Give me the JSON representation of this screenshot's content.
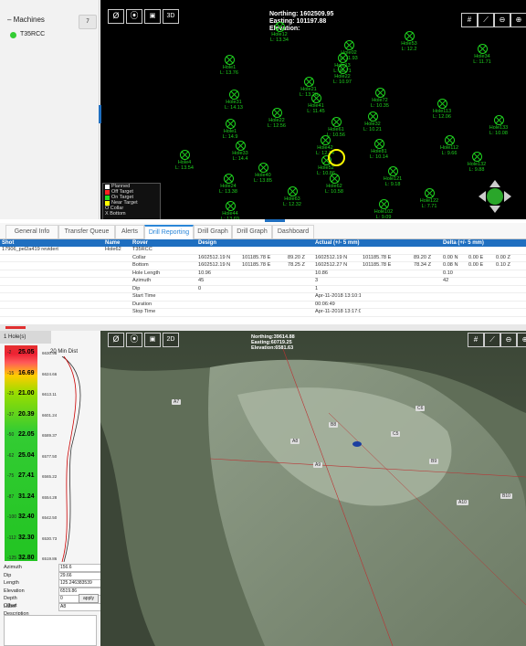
{
  "machines": {
    "title": "Machines",
    "badge": "7",
    "items": [
      {
        "name": "T35RCC",
        "status_color": "#33cc33"
      }
    ]
  },
  "map_top": {
    "northing": "Northing: 1602509.95",
    "easting": "Easting: 101197.88",
    "elevation": "Elevation:",
    "tools_left": [
      "target-circle-icon",
      "crosshair-icon",
      "camera-icon",
      "3d-icon"
    ],
    "tools_left_labels": [
      "Ø",
      "⦿",
      "📷",
      "3D"
    ],
    "tools_right": [
      "grid-icon",
      "measure-icon",
      "zoom-out-icon",
      "zoom-in-icon"
    ],
    "holes": [
      {
        "name": "Hole12",
        "len": "L: 13.34"
      },
      {
        "name": "Hole13",
        "len": "L: 11.71"
      },
      {
        "name": "Hole02",
        "len": "L: 11.93"
      },
      {
        "name": "Hole1",
        "len": "L: 13.76"
      },
      {
        "name": "Hole21",
        "len": "L: 13.28"
      },
      {
        "name": "Hole22",
        "len": "L: 10.97"
      },
      {
        "name": "Hole53",
        "len": "L: 12.2"
      },
      {
        "name": "Hole31",
        "len": "L: 14.13"
      },
      {
        "name": "Hole41",
        "len": "L: 11.45"
      },
      {
        "name": "Hole72",
        "len": "L: 10.35"
      },
      {
        "name": "Hole34",
        "len": "L: 11.71"
      },
      {
        "name": "Hole22",
        "len": "L: 12.56"
      },
      {
        "name": "Hole61",
        "len": "L: 10.56"
      },
      {
        "name": "Hole32",
        "len": "L: 10.21"
      },
      {
        "name": "Hole1",
        "len": "L: 14.9"
      },
      {
        "name": "Hole42",
        "len": "L: 12.14"
      },
      {
        "name": "Hole113",
        "len": "L: 12.06"
      },
      {
        "name": "Hole133",
        "len": "L: 10.08"
      },
      {
        "name": "Hole33",
        "len": "L: 14.4"
      },
      {
        "name": "Hole52",
        "len": "L: 10.86"
      },
      {
        "name": "Hole81",
        "len": "L: 10.14"
      },
      {
        "name": "Hole112",
        "len": "L: 9.66"
      },
      {
        "name": "Hole4",
        "len": "L: 13.54"
      },
      {
        "name": "Hole40",
        "len": "L: 13.85"
      },
      {
        "name": "Hole132",
        "len": "L: 9.88"
      },
      {
        "name": "Hole121",
        "len": "L: 9.18"
      },
      {
        "name": "Hole24",
        "len": "L: 13.38"
      },
      {
        "name": "Hole62",
        "len": "L: 10.58"
      },
      {
        "name": "Hole63",
        "len": "L: 12.32"
      },
      {
        "name": "Hole5",
        "len": "L: 3.35"
      },
      {
        "name": "Hole44",
        "len": "L: 13.69"
      },
      {
        "name": "Hole102",
        "len": "L: 9.09"
      },
      {
        "name": "Hole122",
        "len": "L: 7.71"
      }
    ],
    "legend": [
      {
        "label": "Planned",
        "color": "#ffffff"
      },
      {
        "label": "Off Target",
        "color": "#ff2222"
      },
      {
        "label": "On Target",
        "color": "#22dd22"
      },
      {
        "label": "Near Target",
        "color": "#ffff00"
      },
      {
        "label": "O Collar",
        "color": ""
      },
      {
        "label": "X Bottom",
        "color": ""
      }
    ]
  },
  "tabs": [
    {
      "label": "General Info"
    },
    {
      "label": "Transfer Queue"
    },
    {
      "label": "Alerts"
    },
    {
      "label": "Drill Reporting",
      "active": true
    },
    {
      "label": "Drill Graph"
    },
    {
      "label": "Drill Graph"
    },
    {
      "label": "Dashboard"
    }
  ],
  "report": {
    "headers": [
      "Shot",
      "Name",
      "Rover",
      "Design",
      "",
      "",
      "Actual (+/- 5 mm)",
      "",
      "",
      "Delta (+/- 5 mm)",
      "",
      ""
    ],
    "shot": "17906_pel2a419 revidert",
    "name": "Hole62",
    "rows": [
      [
        "",
        "",
        "T35RCC",
        "",
        "",
        "",
        "",
        "",
        "",
        "",
        "",
        ""
      ],
      [
        "",
        "",
        "Collar",
        "1602512.19 N",
        "101185.78 E",
        "89.20 Z",
        "1602512.19 N",
        "101185.78 E",
        "89.20 Z",
        "0.00 N",
        "0.00 E",
        "0.00 Z"
      ],
      [
        "",
        "",
        "Bottom",
        "1602512.19 N",
        "101185.78 E",
        "78.25 Z",
        "1602512.27 N",
        "101185.78 E",
        "78.34 Z",
        "0.08 N",
        "0.00 E",
        "0.10 Z"
      ],
      [
        "",
        "",
        "Hole Length",
        "10.96",
        "",
        "",
        "10.86",
        "",
        "",
        "0.10",
        "",
        ""
      ],
      [
        "",
        "",
        "Azimuth",
        "45",
        "",
        "",
        "3",
        "",
        "",
        "42",
        "",
        ""
      ],
      [
        "",
        "",
        "Dip",
        "0",
        "",
        "",
        "1",
        "",
        "",
        "",
        "",
        ""
      ],
      [
        "",
        "",
        "Start Time",
        "",
        "",
        "",
        "Apr-11-2018 13:10:18",
        "",
        "",
        "",
        "",
        ""
      ],
      [
        "",
        "",
        "Duration",
        "",
        "",
        "",
        "00:06:49",
        "",
        "",
        "",
        "",
        ""
      ],
      [
        "",
        "",
        "Stop Time",
        "",
        "",
        "",
        "Apr-11-2018 13:17:07",
        "",
        "",
        "",
        "",
        ""
      ]
    ]
  },
  "holes_panel": {
    "header": "1 Hole(s)",
    "min_dist": "20 Min Dist",
    "depths": [
      {
        "depth": "-2",
        "val": "25.05",
        "elev": "6630.98"
      },
      {
        "depth": "-15",
        "val": "16.69",
        "elev": "6624.66"
      },
      {
        "depth": "-25",
        "val": "21.00",
        "elev": "6613.11"
      },
      {
        "depth": "-37",
        "val": "20.39",
        "elev": "6601.24"
      },
      {
        "depth": "-50",
        "val": "22.05",
        "elev": "6589.37"
      },
      {
        "depth": "-62",
        "val": "25.04",
        "elev": "6577.50"
      },
      {
        "depth": "-75",
        "val": "27.41",
        "elev": "6565.22"
      },
      {
        "depth": "-87",
        "val": "31.24",
        "elev": "6554.28"
      },
      {
        "depth": "-100",
        "val": "32.40",
        "elev": "6542.50"
      },
      {
        "depth": "-112",
        "val": "32.30",
        "elev": "6530.73"
      },
      {
        "depth": "-125",
        "val": "32.80",
        "elev": "6519.86"
      }
    ],
    "fields": [
      {
        "label": "Azimuth",
        "value": "156.6"
      },
      {
        "label": "Dip",
        "value": "29.66"
      },
      {
        "label": "Length",
        "value": "125.246383539"
      },
      {
        "label": "Elevation",
        "value": "6519.86"
      },
      {
        "label": "Depth Offset",
        "value": "0"
      },
      {
        "label": "Label",
        "value": "A8"
      },
      {
        "label": "Description",
        "value": ""
      }
    ],
    "apply_label": "apply"
  },
  "map_3d": {
    "northing": "Northing:39614.88",
    "easting": "Easting:60719.25",
    "elevation": "Elevation:6581.63",
    "tags": [
      "A7",
      "A8",
      "A9",
      "B8",
      "B9",
      "B10",
      "A10",
      "C5",
      "C6"
    ]
  }
}
